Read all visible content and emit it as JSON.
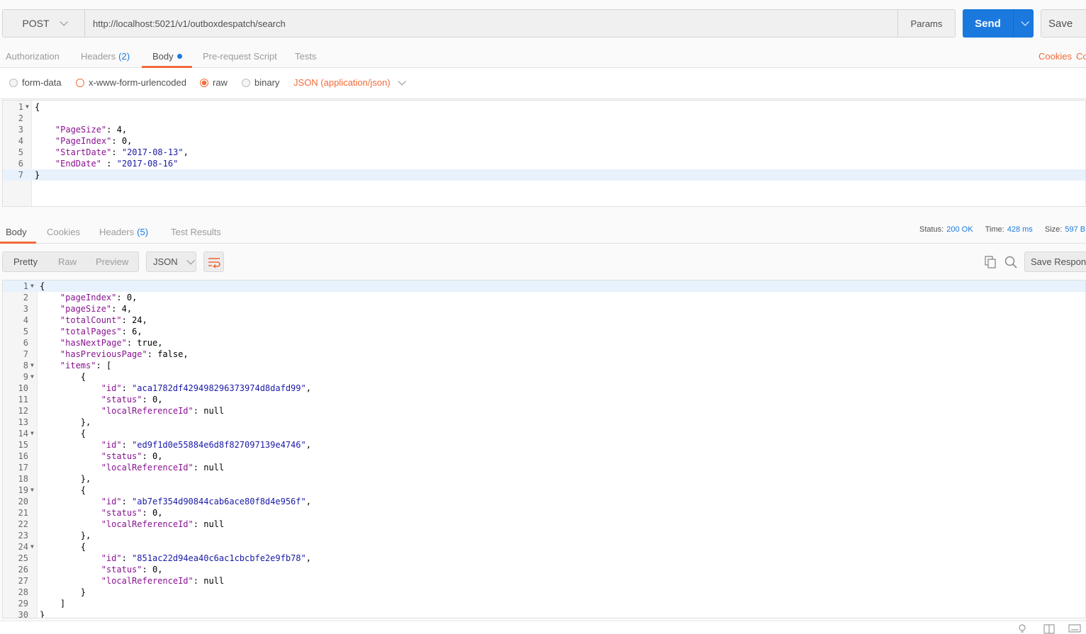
{
  "request": {
    "method": "POST",
    "url": "http://localhost:5021/v1/outboxdespatch/search",
    "params_label": "Params",
    "send_label": "Send",
    "save_label": "Save"
  },
  "request_tabs": {
    "authorization": "Authorization",
    "headers": "Headers",
    "headers_count": "(2)",
    "body": "Body",
    "prerequest": "Pre-request Script",
    "tests": "Tests",
    "cookies": "Cookies",
    "code": "Co"
  },
  "body_types": {
    "form_data": "form-data",
    "urlencoded": "x-www-form-urlencoded",
    "raw": "raw",
    "binary": "binary",
    "content_type": "JSON (application/json)"
  },
  "request_body": {
    "lines": [
      "{",
      "",
      "    \"PageSize\": 4,",
      "    \"PageIndex\": 0,",
      "    \"StartDate\": \"2017-08-13\",",
      "    \"EndDate\" : \"2017-08-16\"",
      "}"
    ],
    "cursor_line": 7
  },
  "response_tabs": {
    "body": "Body",
    "cookies": "Cookies",
    "headers": "Headers",
    "headers_count": "(5)",
    "test_results": "Test Results"
  },
  "response_meta": {
    "status_label": "Status:",
    "status_value": "200 OK",
    "time_label": "Time:",
    "time_value": "428 ms",
    "size_label": "Size:",
    "size_value": "597 B"
  },
  "response_toolbar": {
    "pretty": "Pretty",
    "raw": "Raw",
    "preview": "Preview",
    "format": "JSON",
    "save_response": "Save Response"
  },
  "response_body": {
    "lines": [
      "{",
      "    \"pageIndex\": 0,",
      "    \"pageSize\": 4,",
      "    \"totalCount\": 24,",
      "    \"totalPages\": 6,",
      "    \"hasNextPage\": true,",
      "    \"hasPreviousPage\": false,",
      "    \"items\": [",
      "        {",
      "            \"id\": \"aca1782df429498296373974d8dafd99\",",
      "            \"status\": 0,",
      "            \"localReferenceId\": null",
      "        },",
      "        {",
      "            \"id\": \"ed9f1d0e55884e6d8f827097139e4746\",",
      "            \"status\": 0,",
      "            \"localReferenceId\": null",
      "        },",
      "        {",
      "            \"id\": \"ab7ef354d90844cab6ace80f8d4e956f\",",
      "            \"status\": 0,",
      "            \"localReferenceId\": null",
      "        },",
      "        {",
      "            \"id\": \"851ac22d94ea40c6ac1cbcbfe2e9fb78\",",
      "            \"status\": 0,",
      "            \"localReferenceId\": null",
      "        }",
      "    ]",
      "}"
    ],
    "fold_lines": [
      1,
      8,
      9,
      14,
      19,
      24
    ]
  }
}
